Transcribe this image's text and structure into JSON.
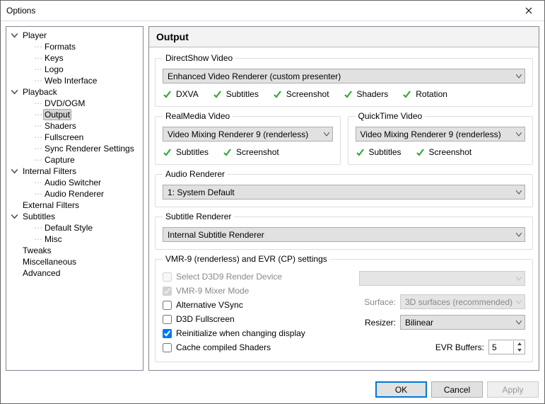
{
  "window": {
    "title": "Options"
  },
  "tree": [
    {
      "label": "Player",
      "depth": 0,
      "expand": true,
      "selected": false
    },
    {
      "label": "Formats",
      "depth": 1,
      "expand": null,
      "selected": false
    },
    {
      "label": "Keys",
      "depth": 1,
      "expand": null,
      "selected": false
    },
    {
      "label": "Logo",
      "depth": 1,
      "expand": null,
      "selected": false
    },
    {
      "label": "Web Interface",
      "depth": 1,
      "expand": null,
      "selected": false
    },
    {
      "label": "Playback",
      "depth": 0,
      "expand": true,
      "selected": false
    },
    {
      "label": "DVD/OGM",
      "depth": 1,
      "expand": null,
      "selected": false
    },
    {
      "label": "Output",
      "depth": 1,
      "expand": null,
      "selected": true
    },
    {
      "label": "Shaders",
      "depth": 1,
      "expand": null,
      "selected": false
    },
    {
      "label": "Fullscreen",
      "depth": 1,
      "expand": null,
      "selected": false
    },
    {
      "label": "Sync Renderer Settings",
      "depth": 1,
      "expand": null,
      "selected": false
    },
    {
      "label": "Capture",
      "depth": 1,
      "expand": null,
      "selected": false
    },
    {
      "label": "Internal Filters",
      "depth": 0,
      "expand": true,
      "selected": false
    },
    {
      "label": "Audio Switcher",
      "depth": 1,
      "expand": null,
      "selected": false
    },
    {
      "label": "Audio Renderer",
      "depth": 1,
      "expand": null,
      "selected": false
    },
    {
      "label": "External Filters",
      "depth": 0,
      "expand": null,
      "selected": false
    },
    {
      "label": "Subtitles",
      "depth": 0,
      "expand": true,
      "selected": false
    },
    {
      "label": "Default Style",
      "depth": 1,
      "expand": null,
      "selected": false
    },
    {
      "label": "Misc",
      "depth": 1,
      "expand": null,
      "selected": false
    },
    {
      "label": "Tweaks",
      "depth": 0,
      "expand": null,
      "selected": false
    },
    {
      "label": "Miscellaneous",
      "depth": 0,
      "expand": null,
      "selected": false
    },
    {
      "label": "Advanced",
      "depth": 0,
      "expand": null,
      "selected": false
    }
  ],
  "page": {
    "title": "Output",
    "directshow": {
      "legend": "DirectShow Video",
      "value": "Enhanced Video Renderer (custom presenter)",
      "features": [
        "DXVA",
        "Subtitles",
        "Screenshot",
        "Shaders",
        "Rotation"
      ]
    },
    "realmedia": {
      "legend": "RealMedia Video",
      "value": "Video Mixing Renderer 9 (renderless)",
      "features": [
        "Subtitles",
        "Screenshot"
      ]
    },
    "quicktime": {
      "legend": "QuickTime Video",
      "value": "Video Mixing Renderer 9 (renderless)",
      "features": [
        "Subtitles",
        "Screenshot"
      ]
    },
    "audio": {
      "legend": "Audio Renderer",
      "value": "1: System Default"
    },
    "subtitle": {
      "legend": "Subtitle Renderer",
      "value": "Internal Subtitle Renderer"
    },
    "vmr": {
      "legend": "VMR-9 (renderless) and EVR (CP) settings",
      "select_d3d9_label": "Select D3D9 Render Device",
      "select_d3d9_checked": false,
      "select_d3d9_enabled": false,
      "d3d9_device_value": "",
      "mixer_label": "VMR-9 Mixer Mode",
      "mixer_checked": true,
      "mixer_enabled": false,
      "alt_vsync_label": "Alternative VSync",
      "alt_vsync_checked": false,
      "d3d_full_label": "D3D Fullscreen",
      "d3d_full_checked": false,
      "reinit_label": "Reinitialize when changing display",
      "reinit_checked": true,
      "cache_label": "Cache compiled Shaders",
      "cache_checked": false,
      "surface_label": "Surface:",
      "surface_value": "3D surfaces (recommended)",
      "surface_enabled": false,
      "resizer_label": "Resizer:",
      "resizer_value": "Bilinear",
      "evr_buffers_label": "EVR Buffers:",
      "evr_buffers_value": "5"
    }
  },
  "buttons": {
    "ok": "OK",
    "cancel": "Cancel",
    "apply": "Apply"
  }
}
